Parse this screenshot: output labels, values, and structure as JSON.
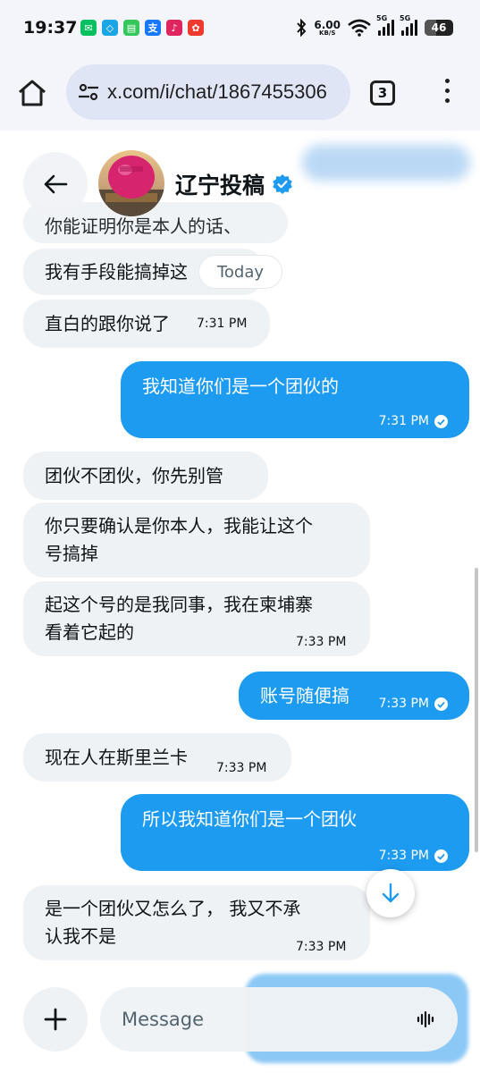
{
  "status_bar": {
    "time": "19:37",
    "net_speed": "6.00",
    "net_unit": "KB/S",
    "signal1_label": "5G",
    "signal2_label": "5G",
    "battery": "46",
    "apps": [
      {
        "name": "wechat-icon",
        "color": "#07c160",
        "glyph": "✉"
      },
      {
        "name": "china-mobile-icon",
        "color": "#1aa5e6",
        "glyph": "◇"
      },
      {
        "name": "messages-icon",
        "color": "#34c759",
        "glyph": "▤"
      },
      {
        "name": "alipay-icon",
        "color": "#1677ff",
        "glyph": "支"
      },
      {
        "name": "music-icon",
        "color": "#e0245e",
        "glyph": "♪"
      },
      {
        "name": "red-app-icon",
        "color": "#ef3b2d",
        "glyph": "✿"
      }
    ]
  },
  "browser": {
    "url": "x.com/i/chat/1867455306",
    "tab_count": "3"
  },
  "chat": {
    "title": "辽宁投稿",
    "today_label": "Today"
  },
  "messages": [
    {
      "dir": "in",
      "text": "你能证明你是本人的话、",
      "time": ""
    },
    {
      "dir": "in",
      "text": "我有手段能搞掉这",
      "time": ""
    },
    {
      "dir": "in",
      "text": "直白的跟你说了",
      "time": "7:31 PM"
    },
    {
      "dir": "out",
      "text": "我知道你们是一个团伙的",
      "time": "7:31 PM"
    },
    {
      "dir": "in",
      "text": "团伙不团伙，你先别管",
      "time": ""
    },
    {
      "dir": "in",
      "text": "你只要确认是你本人，我能让这个号搞掉",
      "line1": "你只要确认是你本人，我能让这个",
      "line2": "号搞掉",
      "time": ""
    },
    {
      "dir": "in",
      "text": "起这个号的是我同事，我在柬埔寨看着它起的",
      "line1": "起这个号的是我同事，我在柬埔寨",
      "line2": "看着它起的",
      "time": "7:33 PM"
    },
    {
      "dir": "out",
      "text": "账号随便搞",
      "time": "7:33 PM"
    },
    {
      "dir": "in",
      "text": "现在人在斯里兰卡",
      "time": "7:33 PM"
    },
    {
      "dir": "out",
      "text": "所以我知道你们是一个团伙",
      "time": "7:33 PM"
    },
    {
      "dir": "in",
      "text": "是一个团伙又怎么了， 我又不承认我不是",
      "line1": "是一个团伙又怎么了， 我又不承",
      "line2": "认我不是",
      "time": "7:33 PM"
    }
  ],
  "composer": {
    "placeholder": "Message"
  }
}
